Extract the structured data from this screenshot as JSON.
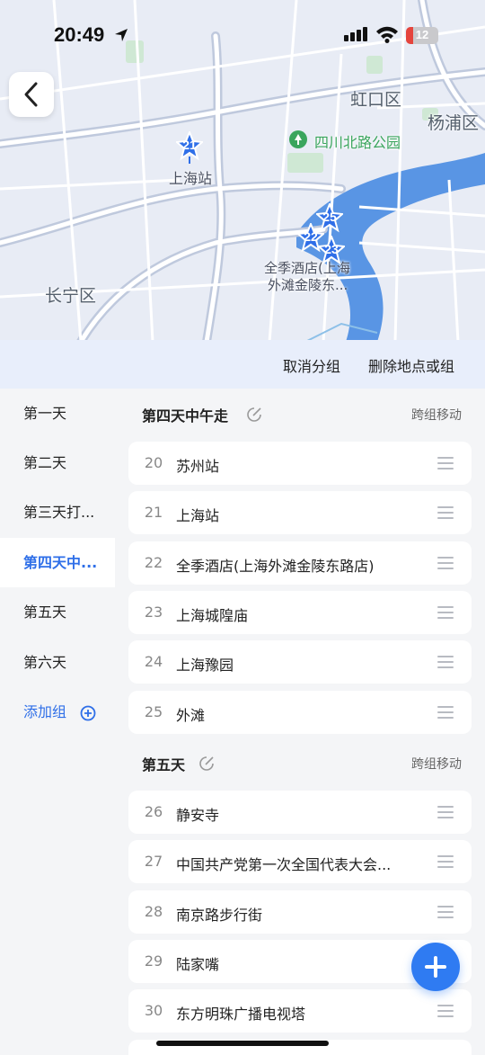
{
  "status_bar": {
    "time": "20:49",
    "battery": "12"
  },
  "map": {
    "labels": {
      "hongkou": "虹口区",
      "yangpu": "杨浦区",
      "park": "四川北路公园",
      "shanghai_station": "上海站",
      "changning": "长宁区",
      "hotel_line1": "全季酒店(上海",
      "hotel_line2": "外滩金陵东..."
    },
    "pins": [
      "21",
      "25",
      "22",
      "23"
    ],
    "accent_color": "#2f6fe8"
  },
  "actions": {
    "cancel_group": "取消分组",
    "delete": "删除地点或组"
  },
  "sidebar": {
    "items": [
      {
        "label": "第一天"
      },
      {
        "label": "第二天"
      },
      {
        "label": "第三天打..."
      },
      {
        "label": "第四天中..."
      },
      {
        "label": "第五天"
      },
      {
        "label": "第六天"
      }
    ],
    "add_label": "添加组"
  },
  "groups": [
    {
      "title": "第四天中午走",
      "move_label": "跨组移动",
      "items": [
        {
          "no": "20",
          "name": "苏州站"
        },
        {
          "no": "21",
          "name": "上海站"
        },
        {
          "no": "22",
          "name": "全季酒店(上海外滩金陵东路店)"
        },
        {
          "no": "23",
          "name": "上海城隍庙"
        },
        {
          "no": "24",
          "name": "上海豫园"
        },
        {
          "no": "25",
          "name": "外滩"
        }
      ]
    },
    {
      "title": "第五天",
      "move_label": "跨组移动",
      "items": [
        {
          "no": "26",
          "name": "静安寺"
        },
        {
          "no": "27",
          "name": "中国共产党第一次全国代表大会..."
        },
        {
          "no": "28",
          "name": "南京路步行街"
        },
        {
          "no": "29",
          "name": "陆家嘴"
        },
        {
          "no": "30",
          "name": "东方明珠广播电视塔"
        }
      ]
    }
  ]
}
